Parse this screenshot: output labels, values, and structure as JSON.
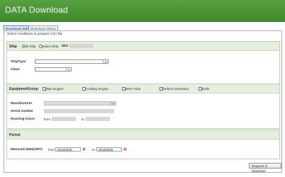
{
  "header": {
    "title": "DATA Download"
  },
  "tabs": [
    {
      "label": "Download Setting",
      "active": true
    },
    {
      "label": "Download History",
      "active": false
    }
  ],
  "hint": "Select conditions to prepare CSV file",
  "ship": {
    "title": "Ship",
    "all_ship": "All Ship",
    "select_ship": "Select Ship",
    "imo": "IMO",
    "selected": "All Ship"
  },
  "ship_filter": {
    "shiptype": "ShipType",
    "class": "Class"
  },
  "equipment": {
    "title": "EquipmentGroup",
    "options": [
      "Main Engine",
      "Auxiliary Engine",
      "Stern Tube",
      "Turbine Generator",
      "Boiler"
    ]
  },
  "equipment_fields": {
    "manufacturer": "Manufacturer",
    "serial": "Serial number",
    "running": "Running hours",
    "from": "from",
    "to": "to"
  },
  "period": {
    "title": "Period",
    "measured": "Mesured date(GMT)",
    "from": "from",
    "from_value": "20160225",
    "to": "to",
    "to_value": "20160325"
  },
  "actions": {
    "request": "Request of download"
  },
  "colors": {
    "header": "#4a9634",
    "section_head": "#e6efdf"
  }
}
